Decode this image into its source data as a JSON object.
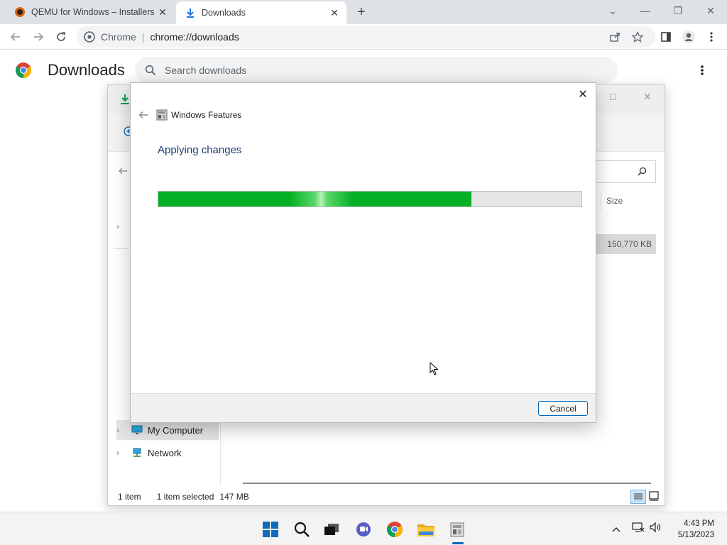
{
  "browser": {
    "tabs": [
      {
        "title": "QEMU for Windows – Installers (",
        "icon": "qemu-favicon-icon",
        "active": false
      },
      {
        "title": "Downloads",
        "icon": "download-icon",
        "active": true
      }
    ],
    "omnibox": {
      "site_label": "Chrome",
      "url": "chrome://downloads"
    }
  },
  "downloads_page": {
    "title": "Downloads",
    "search_placeholder": "Search downloads"
  },
  "explorer": {
    "column_size_header": "Size",
    "selected_file_size": "150,770 KB",
    "nav_items": [
      {
        "label": "My Computer",
        "icon": "monitor-icon",
        "selected": true
      },
      {
        "label": "Network",
        "icon": "network-icon",
        "selected": false
      }
    ],
    "status": {
      "items": "1 item",
      "selected": "1 item selected",
      "size": "147 MB"
    }
  },
  "dialog": {
    "app_title": "Windows Features",
    "heading": "Applying changes",
    "progress_fraction": 0.74,
    "cancel_label": "Cancel"
  },
  "taskbar": {
    "apps": [
      "windows-start-icon",
      "search-icon",
      "task-view-icon",
      "teams-chat-icon",
      "chrome-icon",
      "file-explorer-icon",
      "windows-features-icon"
    ],
    "clock": {
      "time": "4:43 PM",
      "date": "5/13/2023"
    }
  }
}
